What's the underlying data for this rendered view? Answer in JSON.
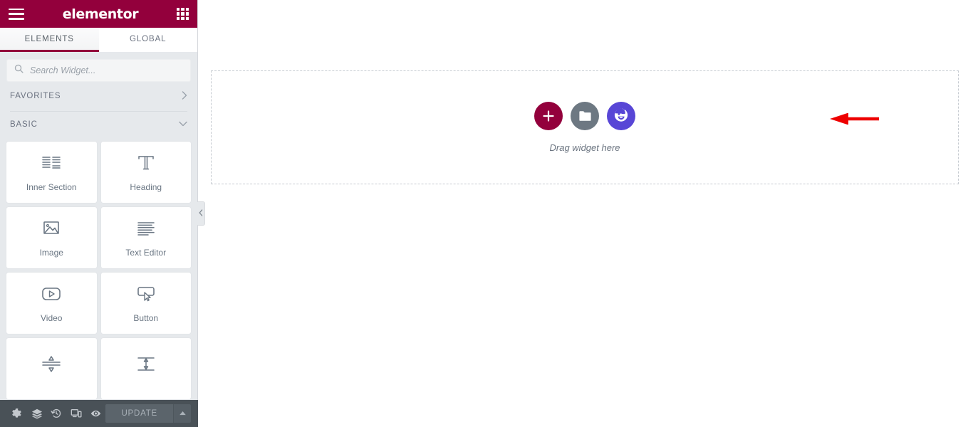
{
  "panel": {
    "header": {
      "menu_icon": "hamburger-menu-icon",
      "brand": "elementor",
      "apps_icon": "grid-apps-icon"
    },
    "tabs": [
      {
        "label": "ELEMENTS",
        "active": true
      },
      {
        "label": "GLOBAL",
        "active": false
      }
    ],
    "search": {
      "placeholder": "Search Widget...",
      "value": "",
      "icon": "search-icon"
    },
    "categories": [
      {
        "label": "FAVORITES",
        "state": "collapsed",
        "chevron": "›"
      },
      {
        "label": "BASIC",
        "state": "expanded",
        "chevron": "⌄"
      }
    ],
    "widgets": [
      {
        "label": "Inner Section",
        "icon": "inner-section-icon"
      },
      {
        "label": "Heading",
        "icon": "heading-t-icon"
      },
      {
        "label": "Image",
        "icon": "image-icon"
      },
      {
        "label": "Text Editor",
        "icon": "text-editor-icon"
      },
      {
        "label": "Video",
        "icon": "video-play-icon"
      },
      {
        "label": "Button",
        "icon": "button-cursor-icon"
      },
      {
        "label": "",
        "icon": "divider-icon"
      },
      {
        "label": "",
        "icon": "spacer-icon"
      }
    ],
    "footer": {
      "icons": [
        {
          "name": "settings-gear-icon"
        },
        {
          "name": "navigator-layers-icon"
        },
        {
          "name": "history-clock-icon"
        },
        {
          "name": "responsive-mode-icon"
        },
        {
          "name": "preview-eye-icon"
        }
      ],
      "update_label": "UPDATE",
      "caret": "▲"
    },
    "collapse_handle_icon": "chevron-left-icon"
  },
  "canvas": {
    "drop_zone": {
      "drag_text": "Drag widget here",
      "buttons": [
        {
          "name": "add-new-section-button",
          "icon": "plus-icon",
          "color": "#93003c"
        },
        {
          "name": "add-template-button",
          "icon": "folder-icon",
          "color": "#6d7882"
        },
        {
          "name": "ai-builder-button",
          "icon": "ai-face-icon",
          "color": "#5846d6"
        }
      ]
    },
    "annotation": {
      "name": "red-pointer-arrow",
      "color": "#ee0000"
    }
  },
  "colors": {
    "brand_maroon": "#93003c",
    "panel_bg": "#e6e9ec",
    "footer_bg": "#495157",
    "ai_purple": "#5846d6",
    "folder_gray": "#6d7882",
    "annotation_red": "#ee0000"
  }
}
